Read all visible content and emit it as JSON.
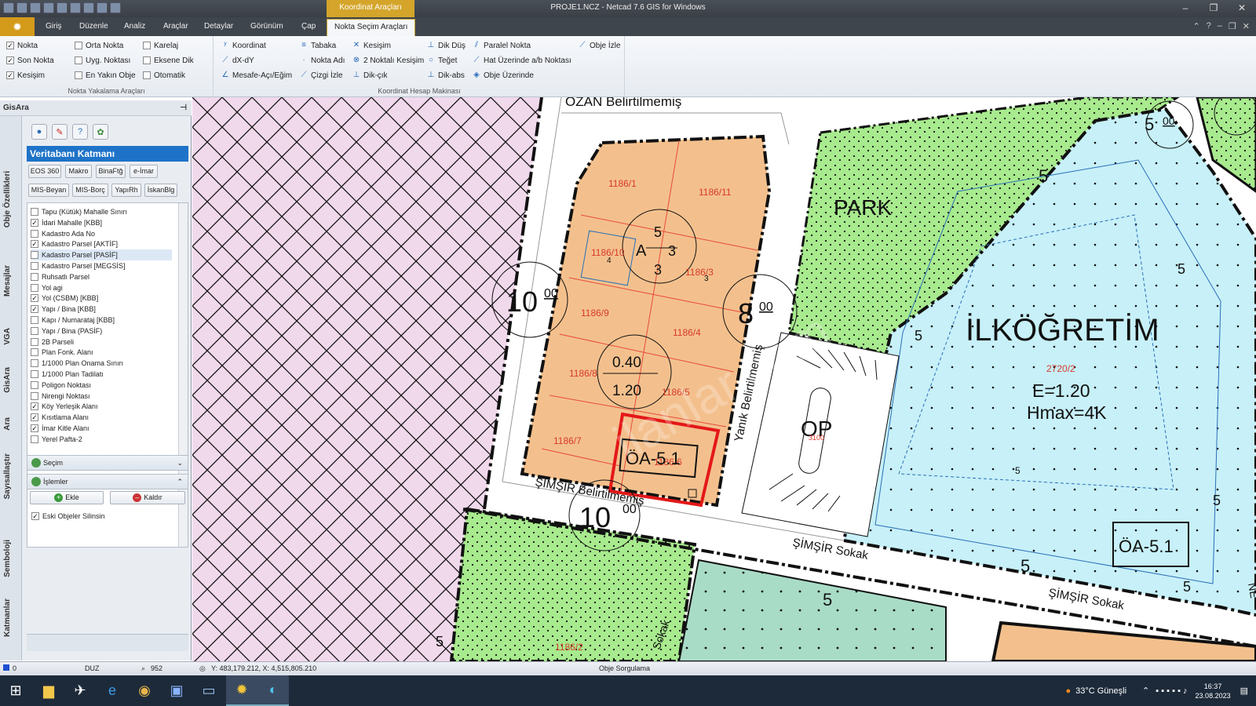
{
  "window": {
    "title": "PROJE1.NCZ - Netcad 7.6 GIS for Windows",
    "context_tab": "Koordinat Araçları",
    "buttons": [
      "–",
      "❐",
      "✕"
    ]
  },
  "ribbon_tabs": [
    "Giriş",
    "Düzenle",
    "Analiz",
    "Araçlar",
    "Detaylar",
    "Görünüm",
    "Çap",
    "Nokta Seçim Araçları"
  ],
  "ribbon": {
    "snap": {
      "caption": "Nokta Yakalama Araçları",
      "items": [
        {
          "label": "Nokta",
          "checked": true
        },
        {
          "label": "Son Nokta",
          "checked": true
        },
        {
          "label": "Kesişim",
          "checked": true
        },
        {
          "label": "Orta Nokta",
          "checked": false
        },
        {
          "label": "Uyg. Noktası",
          "checked": false
        },
        {
          "label": "En Yakın Obje",
          "checked": false
        },
        {
          "label": "Karelaj",
          "checked": false
        },
        {
          "label": "Eksene Dik",
          "checked": false
        },
        {
          "label": "Otomatik",
          "checked": false
        }
      ]
    },
    "coord": {
      "caption": "Koordinat Hesap Makinası",
      "items": [
        {
          "label": "Koordinat",
          "icon": "xyz-icon"
        },
        {
          "label": "dX-dY",
          "icon": "dxdy-icon"
        },
        {
          "label": "Mesafe-Açı/Eğim",
          "icon": "angle-icon"
        },
        {
          "label": "Tabaka",
          "icon": "layers-icon"
        },
        {
          "label": "Nokta Adı",
          "icon": "point-name-icon"
        },
        {
          "label": "Çizgi İzle",
          "icon": "line-trace-icon"
        },
        {
          "label": "Kesişim",
          "icon": "intersection-icon"
        },
        {
          "label": "2 Noktalı Kesişim",
          "icon": "two-point-icon"
        },
        {
          "label": "Dik-çık",
          "icon": "perp-out-icon"
        },
        {
          "label": "Dik Düş",
          "icon": "perp-drop-icon"
        },
        {
          "label": "Teğet",
          "icon": "tangent-icon"
        },
        {
          "label": "Dik-abs",
          "icon": "perp-abs-icon"
        },
        {
          "label": "Paralel Nokta",
          "icon": "parallel-icon"
        },
        {
          "label": "Hat Üzerinde a/b Noktası",
          "icon": "ab-point-icon"
        },
        {
          "label": "Obje Üzerinde",
          "icon": "on-object-icon"
        },
        {
          "label": "Obje İzle",
          "icon": "object-trace-icon"
        }
      ]
    }
  },
  "panel": {
    "title": "GisAra",
    "vertical_tabs": [
      "Obje Özellikleri",
      "Mesajlar",
      "VGA",
      "GisAra",
      "Ara",
      "Sayısallaştır",
      "Semboloji",
      "Katmanlar"
    ],
    "db_header": "Veritabanı Katmanı",
    "buttons_row1": [
      "EOS 360",
      "Makro",
      "BinaFtğ",
      "e-İmar"
    ],
    "buttons_row2": [
      "MIS-Beyan",
      "MIS-Borç",
      "YapıRh",
      "İskanBlg"
    ],
    "layers": [
      {
        "label": "Tapu (Kütük) Mahalle Sınırı",
        "checked": false
      },
      {
        "label": "İdari Mahalle [KBB]",
        "checked": true
      },
      {
        "label": "Kadastro Ada No",
        "checked": false
      },
      {
        "label": "Kadastro Parsel [AKTİF]",
        "checked": true
      },
      {
        "label": "Kadastro Parsel [PASİF]",
        "checked": false
      },
      {
        "label": "Kadastro Parsel [MEGSİS]",
        "checked": false
      },
      {
        "label": "Ruhsatlı Parsel",
        "checked": false
      },
      {
        "label": "Yol agi",
        "checked": false
      },
      {
        "label": "Yol (CSBM) [KBB]",
        "checked": true
      },
      {
        "label": "Yapı / Bina [KBB]",
        "checked": true
      },
      {
        "label": "Kapı / Numarataj [KBB]",
        "checked": false
      },
      {
        "label": "Yapı / Bina (PASİF)",
        "checked": false
      },
      {
        "label": "2B Parseli",
        "checked": false
      },
      {
        "label": "Plan Fonk. Alanı",
        "checked": false
      },
      {
        "label": "1/1000 Plan Onama Sınırı",
        "checked": false
      },
      {
        "label": "1/1000 Plan Tadilatı",
        "checked": false
      },
      {
        "label": "Poligon Noktası",
        "checked": false
      },
      {
        "label": "Nirengi Noktası",
        "checked": false
      },
      {
        "label": "Köy Yerleşik Alanı",
        "checked": true
      },
      {
        "label": "Kısıtlama Alanı",
        "checked": true
      },
      {
        "label": "İmar Kitle Alanı",
        "checked": true
      },
      {
        "label": "Yerel Pafta-2",
        "checked": false
      }
    ],
    "selection_label": "Seçim",
    "operations_label": "İşlemler",
    "add_label": "Ekle",
    "remove_label": "Kaldır",
    "delete_old_label": "Eski Objeler Silinsin",
    "delete_old_checked": true
  },
  "map": {
    "parcels": [
      "1186/1",
      "1186/11",
      "1186/10",
      "1186/3",
      "1186/9",
      "1186/4",
      "1186/8",
      "1186/5",
      "1186/7",
      "1186/6"
    ],
    "parcel_small": [
      "4",
      "3"
    ],
    "road_widths": [
      "10",
      "00",
      "8",
      "00",
      "10",
      "00",
      "5",
      "00"
    ],
    "streets": [
      "ÖZAN Belirtilmemiş",
      "Yanık Belirtilmemiş",
      "ŞİMŞİR Belirtilmemiş",
      "ŞİMŞİR Sokak",
      "ŞİMŞİR Sokak",
      "Sokak",
      "NE"
    ],
    "zone_A": {
      "letter": "A",
      "top": "5",
      "right": "3",
      "bottom": "3"
    },
    "taks": "0.40",
    "kaks": "1.20",
    "oa_left": "ÖA-5.1",
    "oa_right": "ÖA-5.1",
    "park": "PARK",
    "op": "OP",
    "school": "İLKÖĞRETİM",
    "school_parcel": "2720/2",
    "school_e": "E=1.20",
    "school_h": "Hmax=4K",
    "setbacks": [
      "5",
      "5",
      "5",
      "5",
      "5",
      "5",
      "5",
      "5",
      "5"
    ],
    "misc_numbers": [
      "1186/2",
      "3100"
    ]
  },
  "status": {
    "layer": "0",
    "mode": "DUZ",
    "zoom": "952",
    "coords": "Y: 483,179.212, X: 4,515,805.210",
    "query": "Obje Sorgulama"
  },
  "taskbar": {
    "weather": "33°C Güneşli",
    "time": "16:37",
    "date": "23.08.2023"
  }
}
